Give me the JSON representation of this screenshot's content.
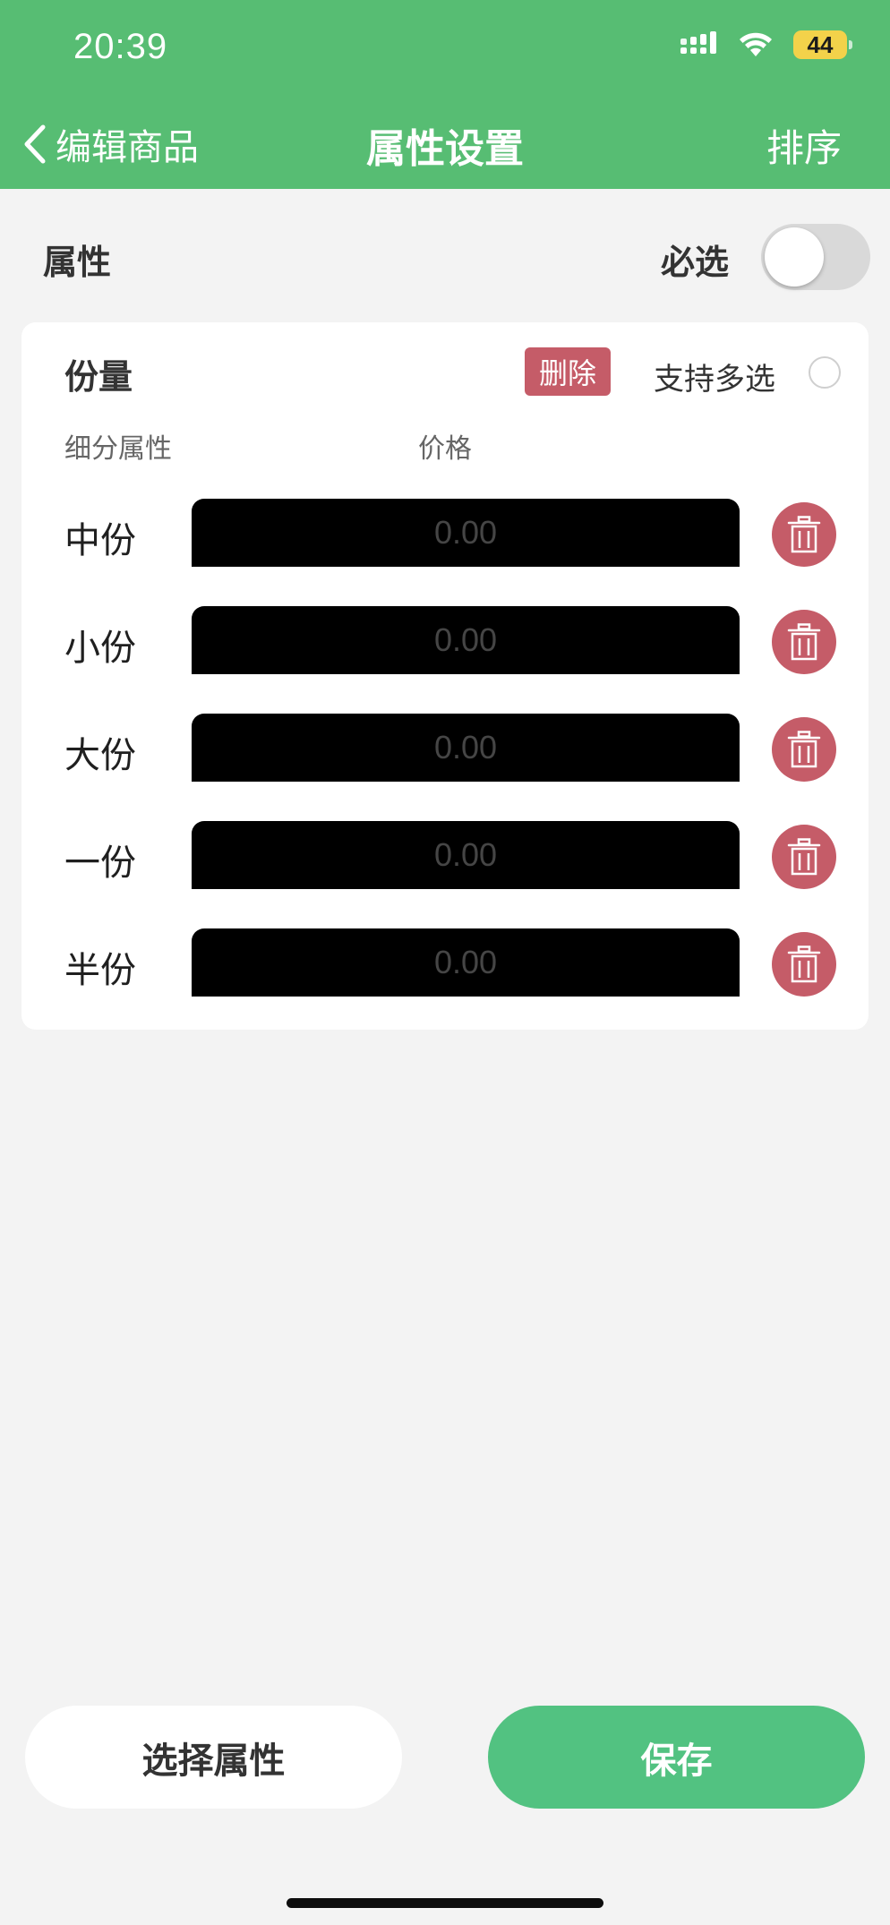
{
  "status_bar": {
    "time": "20:39",
    "battery": "44"
  },
  "nav": {
    "back_label": "编辑商品",
    "title": "属性设置",
    "sort_label": "排序"
  },
  "attribute_row": {
    "label": "属性",
    "required_label": "必选",
    "required_on": false
  },
  "group": {
    "name": "份量",
    "delete_label": "删除",
    "multi_select_label": "支持多选",
    "multi_select_checked": false,
    "col_sub_attr": "细分属性",
    "col_price": "价格",
    "options": [
      {
        "label": "中份",
        "price_placeholder": "0.00"
      },
      {
        "label": "小份",
        "price_placeholder": "0.00"
      },
      {
        "label": "大份",
        "price_placeholder": "0.00"
      },
      {
        "label": "一份",
        "price_placeholder": "0.00"
      },
      {
        "label": "半份",
        "price_placeholder": "0.00"
      }
    ]
  },
  "footer": {
    "select_attr_label": "选择属性",
    "save_label": "保存"
  },
  "colors": {
    "header_green": "#57bd73",
    "save_green": "#52c281",
    "danger_red": "#c55c68",
    "background": "#f3f3f3"
  },
  "icons": {
    "back": "chevron-left-icon",
    "signal": "signal-icon",
    "wifi": "wifi-icon",
    "battery": "battery-icon",
    "trash": "trash-icon"
  }
}
